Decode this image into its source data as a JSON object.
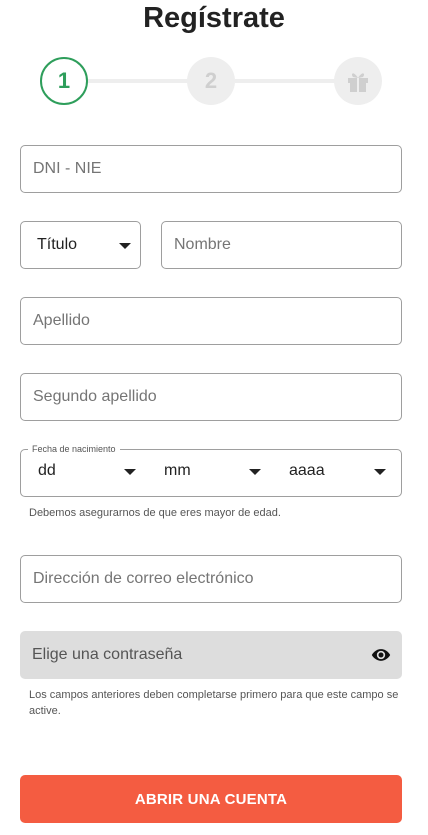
{
  "page": {
    "title": "Regístrate"
  },
  "stepper": {
    "steps": [
      {
        "label": "1",
        "state": "active"
      },
      {
        "label": "2",
        "state": "inactive"
      },
      {
        "icon": "gift-icon",
        "state": "inactive"
      }
    ],
    "active_color": "#2e9e5b",
    "inactive_color": "#eeeeee"
  },
  "form": {
    "dni": {
      "placeholder": "DNI - NIE",
      "value": ""
    },
    "title_select": {
      "value": "Título"
    },
    "first_name": {
      "placeholder": "Nombre",
      "value": ""
    },
    "last_name": {
      "placeholder": "Apellido",
      "value": ""
    },
    "second_last_name": {
      "placeholder": "Segundo apellido",
      "value": ""
    },
    "birthdate": {
      "legend": "Fecha de nacimiento",
      "day": "dd",
      "month": "mm",
      "year": "aaaa",
      "help": "Debemos asegurarnos de que eres mayor de edad."
    },
    "email": {
      "placeholder": "Dirección de correo electrónico",
      "value": ""
    },
    "password": {
      "placeholder": "Elige una contraseña",
      "disabled": true,
      "icon": "eye-icon",
      "help": "Los campos anteriores deben completarse primero para que este campo se active."
    },
    "submit_label": "ABRIR UNA CUENTA"
  },
  "colors": {
    "accent": "#f45c41",
    "success": "#2e9e5b",
    "border": "#9e9e9e",
    "disabled_bg": "#dddddd"
  }
}
